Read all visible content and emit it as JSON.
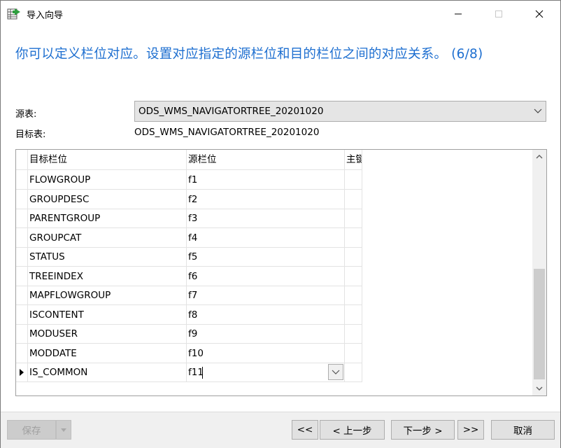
{
  "window": {
    "title": "导入向导"
  },
  "instruction": "你可以定义栏位对应。设置对应指定的源栏位和目的栏位之间的对应关系。 (6/8)",
  "source_table": {
    "label": "源表:",
    "value": "ODS_WMS_NAVIGATORTREE_20201020"
  },
  "target_table": {
    "label": "目标表:",
    "value": "ODS_WMS_NAVIGATORTREE_20201020"
  },
  "grid": {
    "columns": [
      "目标栏位",
      "源栏位",
      "主键"
    ],
    "rows": [
      {
        "target": "FLOWGROUP",
        "source": "f1",
        "pk": ""
      },
      {
        "target": "GROUPDESC",
        "source": "f2",
        "pk": ""
      },
      {
        "target": "PARENTGROUP",
        "source": "f3",
        "pk": ""
      },
      {
        "target": "GROUPCAT",
        "source": "f4",
        "pk": ""
      },
      {
        "target": "STATUS",
        "source": "f5",
        "pk": ""
      },
      {
        "target": "TREEINDEX",
        "source": "f6",
        "pk": ""
      },
      {
        "target": "MAPFLOWGROUP",
        "source": "f7",
        "pk": ""
      },
      {
        "target": "ISCONTENT",
        "source": "f8",
        "pk": ""
      },
      {
        "target": "MODUSER",
        "source": "f9",
        "pk": ""
      },
      {
        "target": "MODDATE",
        "source": "f10",
        "pk": ""
      },
      {
        "target": "IS_COMMON",
        "source": "f11",
        "pk": ""
      }
    ],
    "current_row": 10
  },
  "footer": {
    "save": "保存",
    "first": "<<",
    "prev": "< 上一步",
    "next": "下一步 >",
    "last": ">>",
    "cancel": "取消"
  },
  "colors": {
    "instruction": "#1e6fd0",
    "combo_bg": "#e5e5e5",
    "footer_bg": "#f0f0f0"
  },
  "icons": {
    "app": "import-wizard-icon",
    "minimize": "minimize-icon",
    "maximize": "maximize-icon",
    "close": "close-icon"
  }
}
